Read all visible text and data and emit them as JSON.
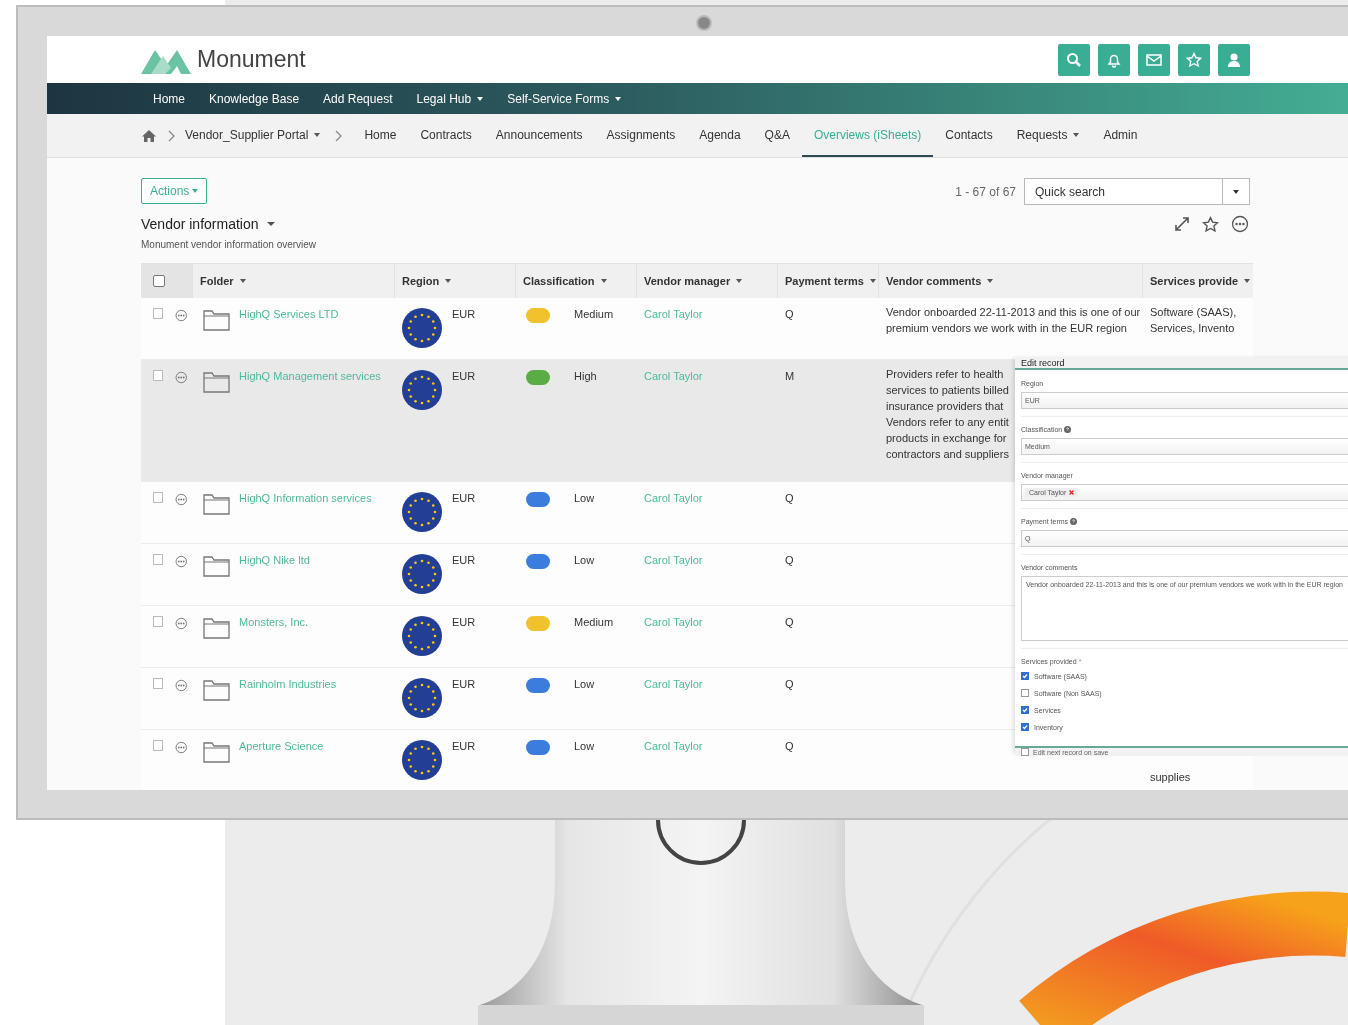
{
  "brand": {
    "name": "Monument"
  },
  "main_nav": [
    {
      "label": "Home",
      "dropdown": false
    },
    {
      "label": "Knowledge Base",
      "dropdown": false
    },
    {
      "label": "Add Request",
      "dropdown": false
    },
    {
      "label": "Legal Hub",
      "dropdown": true
    },
    {
      "label": "Self-Service Forms",
      "dropdown": true
    }
  ],
  "breadcrumb": {
    "portal": "Vendor_Supplier Portal"
  },
  "sub_nav": [
    {
      "label": "Home",
      "selected": false,
      "dropdown": false
    },
    {
      "label": "Contracts",
      "selected": false,
      "dropdown": false
    },
    {
      "label": "Announcements",
      "selected": false,
      "dropdown": false
    },
    {
      "label": "Assignments",
      "selected": false,
      "dropdown": false
    },
    {
      "label": "Agenda",
      "selected": false,
      "dropdown": false
    },
    {
      "label": "Q&A",
      "selected": false,
      "dropdown": false
    },
    {
      "label": "Overviews (iSheets)",
      "selected": true,
      "dropdown": false
    },
    {
      "label": "Contacts",
      "selected": false,
      "dropdown": false
    },
    {
      "label": "Requests",
      "selected": false,
      "dropdown": true
    },
    {
      "label": "Admin",
      "selected": false,
      "dropdown": false
    }
  ],
  "toolbar": {
    "actions": "Actions",
    "count": "1 - 67 of 67",
    "search_placeholder": "Quick search"
  },
  "sheet": {
    "title": "Vendor information",
    "subtitle": "Monument vendor information overview"
  },
  "table": {
    "header_checked": false,
    "columns": [
      "Folder",
      "Region",
      "Classification",
      "Vendor manager",
      "Payment terms",
      "Vendor comments",
      "Services provide"
    ],
    "rows": [
      {
        "folder": "HighQ Services LTD",
        "region": "EUR",
        "classification": "Medium",
        "color": "#f2c12e",
        "manager": "Carol Taylor",
        "payment_terms": "Q",
        "comments": [
          "Vendor onboarded 22-11-2013 and this is one of our",
          "premium vendors we work with in the EUR region"
        ],
        "services": [
          "Software (SAAS),",
          "Services, Invento"
        ],
        "highlighted": false,
        "checked": false
      },
      {
        "folder": "HighQ Management services",
        "region": "EUR",
        "classification": "High",
        "color": "#5aac44",
        "manager": "Carol Taylor",
        "payment_terms": "M",
        "comments": [
          "Providers refer to health",
          "services to patients billed",
          "insurance providers that",
          "Vendors refer to any entit",
          "products in exchange for",
          "contractors and suppliers"
        ],
        "services": [],
        "highlighted": true,
        "checked": false
      },
      {
        "folder": "HighQ Information services",
        "region": "EUR",
        "classification": "Low",
        "color": "#3b7ddd",
        "manager": "Carol Taylor",
        "payment_terms": "Q",
        "comments": [],
        "services": [],
        "highlighted": false,
        "checked": false
      },
      {
        "folder": "HighQ Nike ltd",
        "region": "EUR",
        "classification": "Low",
        "color": "#3b7ddd",
        "manager": "Carol Taylor",
        "payment_terms": "Q",
        "comments": [],
        "services": [],
        "highlighted": false,
        "checked": false
      },
      {
        "folder": "Monsters, Inc.",
        "region": "EUR",
        "classification": "Medium",
        "color": "#f2c12e",
        "manager": "Carol Taylor",
        "payment_terms": "Q",
        "comments": [],
        "services": [],
        "highlighted": false,
        "checked": false
      },
      {
        "folder": "Rainholm Industries",
        "region": "EUR",
        "classification": "Low",
        "color": "#3b7ddd",
        "manager": "Carol Taylor",
        "payment_terms": "Q",
        "comments": [],
        "services": [],
        "highlighted": false,
        "checked": false
      },
      {
        "folder": "Aperture Science",
        "region": "EUR",
        "classification": "Low",
        "color": "#3b7ddd",
        "manager": "Carol Taylor",
        "payment_terms": "Q",
        "comments": [],
        "services": [
          "supplies"
        ],
        "highlighted": false,
        "checked": false
      }
    ]
  },
  "edit_panel": {
    "title": "Edit record",
    "fields": [
      {
        "kind": "select",
        "label": "Region",
        "help": false,
        "value": "EUR"
      },
      {
        "kind": "select",
        "label": "Classification",
        "help": true,
        "value": "Medium"
      },
      {
        "kind": "tags",
        "label": "Vendor manager",
        "help": false,
        "tags": [
          "Carol Taylor"
        ]
      },
      {
        "kind": "select",
        "label": "Payment terms",
        "help": true,
        "value": "Q"
      },
      {
        "kind": "textarea",
        "label": "Vendor comments",
        "help": false,
        "value": "Vendor onboarded 22-11-2013 and this is one of our premium vendors we work with in the EUR region"
      },
      {
        "kind": "checklist",
        "label": "Services provided",
        "help": false,
        "required_mark": "*",
        "options": [
          {
            "label": "Software (SAAS)",
            "checked": true
          },
          {
            "label": "Software (Non SAAS)",
            "checked": false
          },
          {
            "label": "Services",
            "checked": true
          },
          {
            "label": "Inventory",
            "checked": true
          }
        ]
      }
    ],
    "footer": {
      "label": "Edit next record on save",
      "checked": false
    }
  }
}
